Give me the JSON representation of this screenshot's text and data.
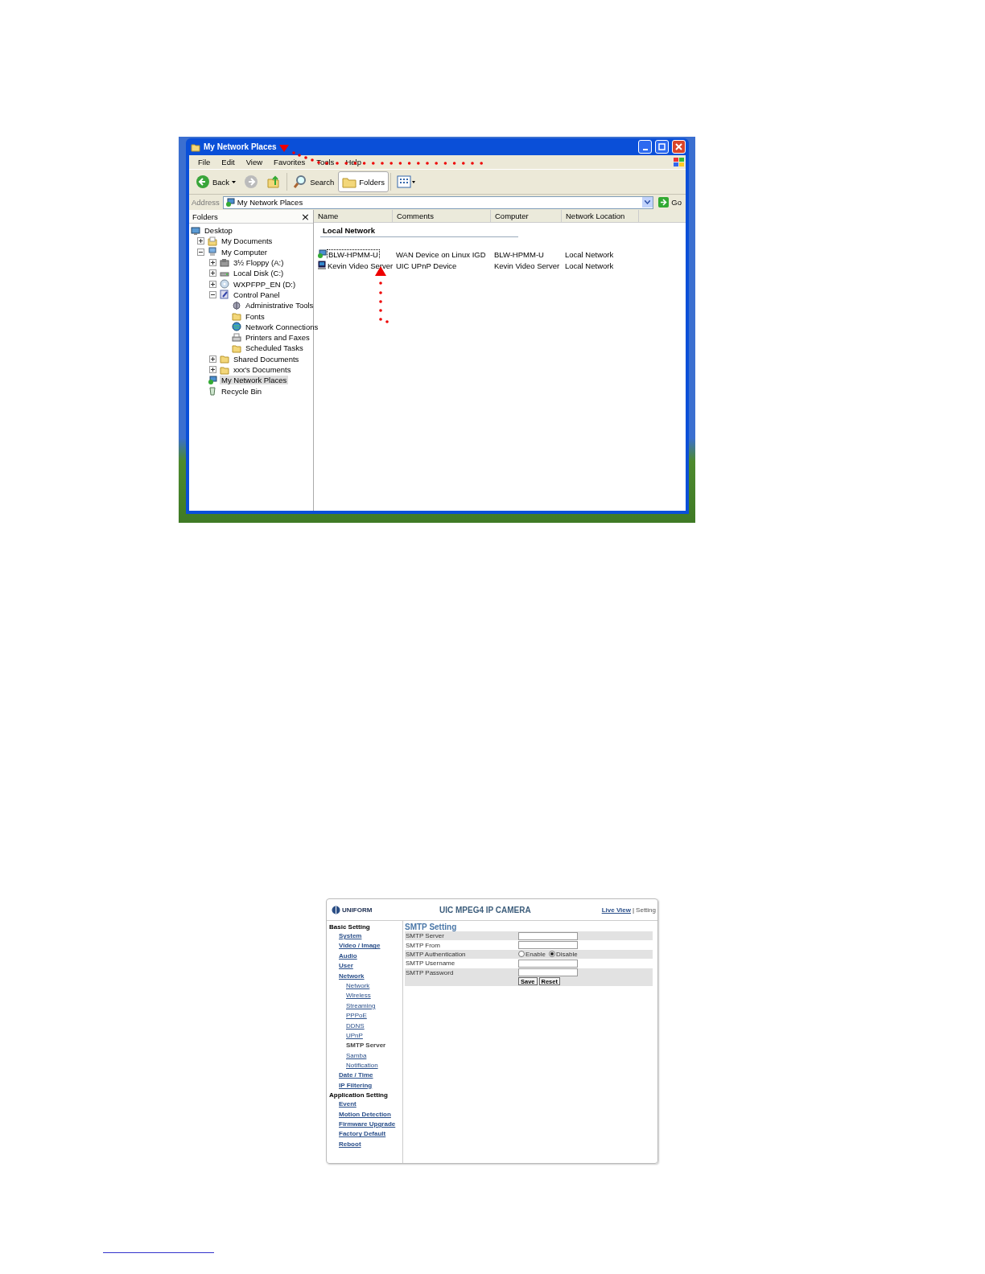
{
  "explorer": {
    "title": "My Network Places",
    "menu": [
      "File",
      "Edit",
      "View",
      "Favorites",
      "Tools",
      "Help"
    ],
    "toolbar": [
      {
        "kind": "back",
        "label": "Back",
        "pressed": false
      },
      {
        "kind": "forward",
        "pressed": false
      },
      {
        "kind": "up",
        "pressed": false
      },
      {
        "kind": "search",
        "label": "Search",
        "pressed": false
      },
      {
        "kind": "folders",
        "label": "Folders",
        "pressed": true
      },
      {
        "kind": "views",
        "pressed": false
      }
    ],
    "address": {
      "label": "Address",
      "value": "My Network Places",
      "go": "Go"
    },
    "folders_pane": {
      "title": "Folders",
      "close": "×",
      "tree": [
        {
          "label": "Desktop",
          "kind": "desktop",
          "selected": false,
          "children": [
            {
              "label": "My Documents",
              "kind": "documents",
              "expanded": false,
              "selected": false
            },
            {
              "label": "My Computer",
              "kind": "computer",
              "expanded": true,
              "selected": false,
              "children": [
                {
                  "label": "3½ Floppy (A:)",
                  "kind": "floppy",
                  "expanded": false,
                  "selected": false
                },
                {
                  "label": "Local Disk (C:)",
                  "kind": "disk",
                  "expanded": false,
                  "selected": false
                },
                {
                  "label": "WXPFPP_EN (D:)",
                  "kind": "cd",
                  "expanded": false,
                  "selected": false
                },
                {
                  "label": "Control Panel",
                  "kind": "control",
                  "expanded": true,
                  "selected": false,
                  "children": [
                    {
                      "label": "Administrative Tools",
                      "kind": "tools",
                      "selected": false
                    },
                    {
                      "label": "Fonts",
                      "kind": "folder",
                      "selected": false
                    },
                    {
                      "label": "Network Connections",
                      "kind": "globe",
                      "selected": false
                    },
                    {
                      "label": "Printers and Faxes",
                      "kind": "printer",
                      "selected": false
                    },
                    {
                      "label": "Scheduled Tasks",
                      "kind": "folder",
                      "selected": false
                    }
                  ]
                },
                {
                  "label": "Shared Documents",
                  "kind": "folder",
                  "expanded": false,
                  "selected": false
                },
                {
                  "label": "xxx's Documents",
                  "kind": "folder",
                  "expanded": false,
                  "selected": false
                }
              ]
            },
            {
              "label": "My Network Places",
              "kind": "network",
              "selected": true
            },
            {
              "label": "Recycle Bin",
              "kind": "recycle",
              "selected": false
            }
          ]
        }
      ]
    },
    "columns": [
      "Name",
      "Comments",
      "Computer",
      "Network Location"
    ],
    "group": "Local Network",
    "rows": [
      {
        "kind": "network",
        "selected": true,
        "cells": [
          "BLW-HPMM-U",
          "WAN Device on Linux IGD",
          "BLW-HPMM-U",
          "Local Network"
        ]
      },
      {
        "kind": "server",
        "selected": false,
        "cells": [
          "Kevin Video Server",
          "UIC UPnP Device",
          "Kevin Video Server",
          "Local Network"
        ]
      }
    ]
  },
  "camera": {
    "logo": "UNIFORM",
    "title": "UIC MPEG4 IP CAMERA",
    "nav": [
      {
        "label": "Live View",
        "selected": false
      },
      {
        "label": "Setting",
        "selected": true
      }
    ],
    "nav_separator": "|",
    "sidebar": [
      {
        "title": "Basic Setting",
        "items": [
          {
            "label": "System",
            "selected": false
          },
          {
            "label": "Video / Image",
            "selected": false
          },
          {
            "label": "Audio",
            "selected": false
          },
          {
            "label": "User",
            "selected": false
          },
          {
            "label": "Network",
            "selected": false,
            "children": [
              {
                "label": "Network",
                "selected": false
              },
              {
                "label": "Wireless",
                "selected": false
              },
              {
                "label": "Streaming",
                "selected": false
              },
              {
                "label": "PPPoE",
                "selected": false
              },
              {
                "label": "DDNS",
                "selected": false
              },
              {
                "label": "UPnP",
                "selected": false
              },
              {
                "label": "SMTP Server",
                "selected": true
              },
              {
                "label": "Samba",
                "selected": false
              },
              {
                "label": "Notification",
                "selected": false
              }
            ]
          },
          {
            "label": "Date / Time",
            "selected": false
          },
          {
            "label": "IP Filtering",
            "selected": false
          }
        ]
      },
      {
        "title": "Application Setting",
        "items": [
          {
            "label": "Event",
            "selected": false
          },
          {
            "label": "Motion Detection",
            "selected": false
          },
          {
            "label": "Firmware Upgrade",
            "selected": false
          },
          {
            "label": "Factory Default",
            "selected": false
          },
          {
            "label": "Reboot",
            "selected": false
          }
        ]
      }
    ],
    "form_title": "SMTP Setting",
    "fields": [
      {
        "kind": "text",
        "label": "SMTP Server"
      },
      {
        "kind": "text",
        "label": "SMTP From"
      },
      {
        "kind": "radio",
        "label": "SMTP Authentication",
        "options": [
          {
            "label": "Enable",
            "selected": false
          },
          {
            "label": "Disable",
            "selected": true
          }
        ]
      },
      {
        "kind": "text",
        "label": "SMTP Username"
      },
      {
        "kind": "password",
        "label": "SMTP Password"
      }
    ],
    "buttons": [
      "Save",
      "Reset"
    ]
  }
}
